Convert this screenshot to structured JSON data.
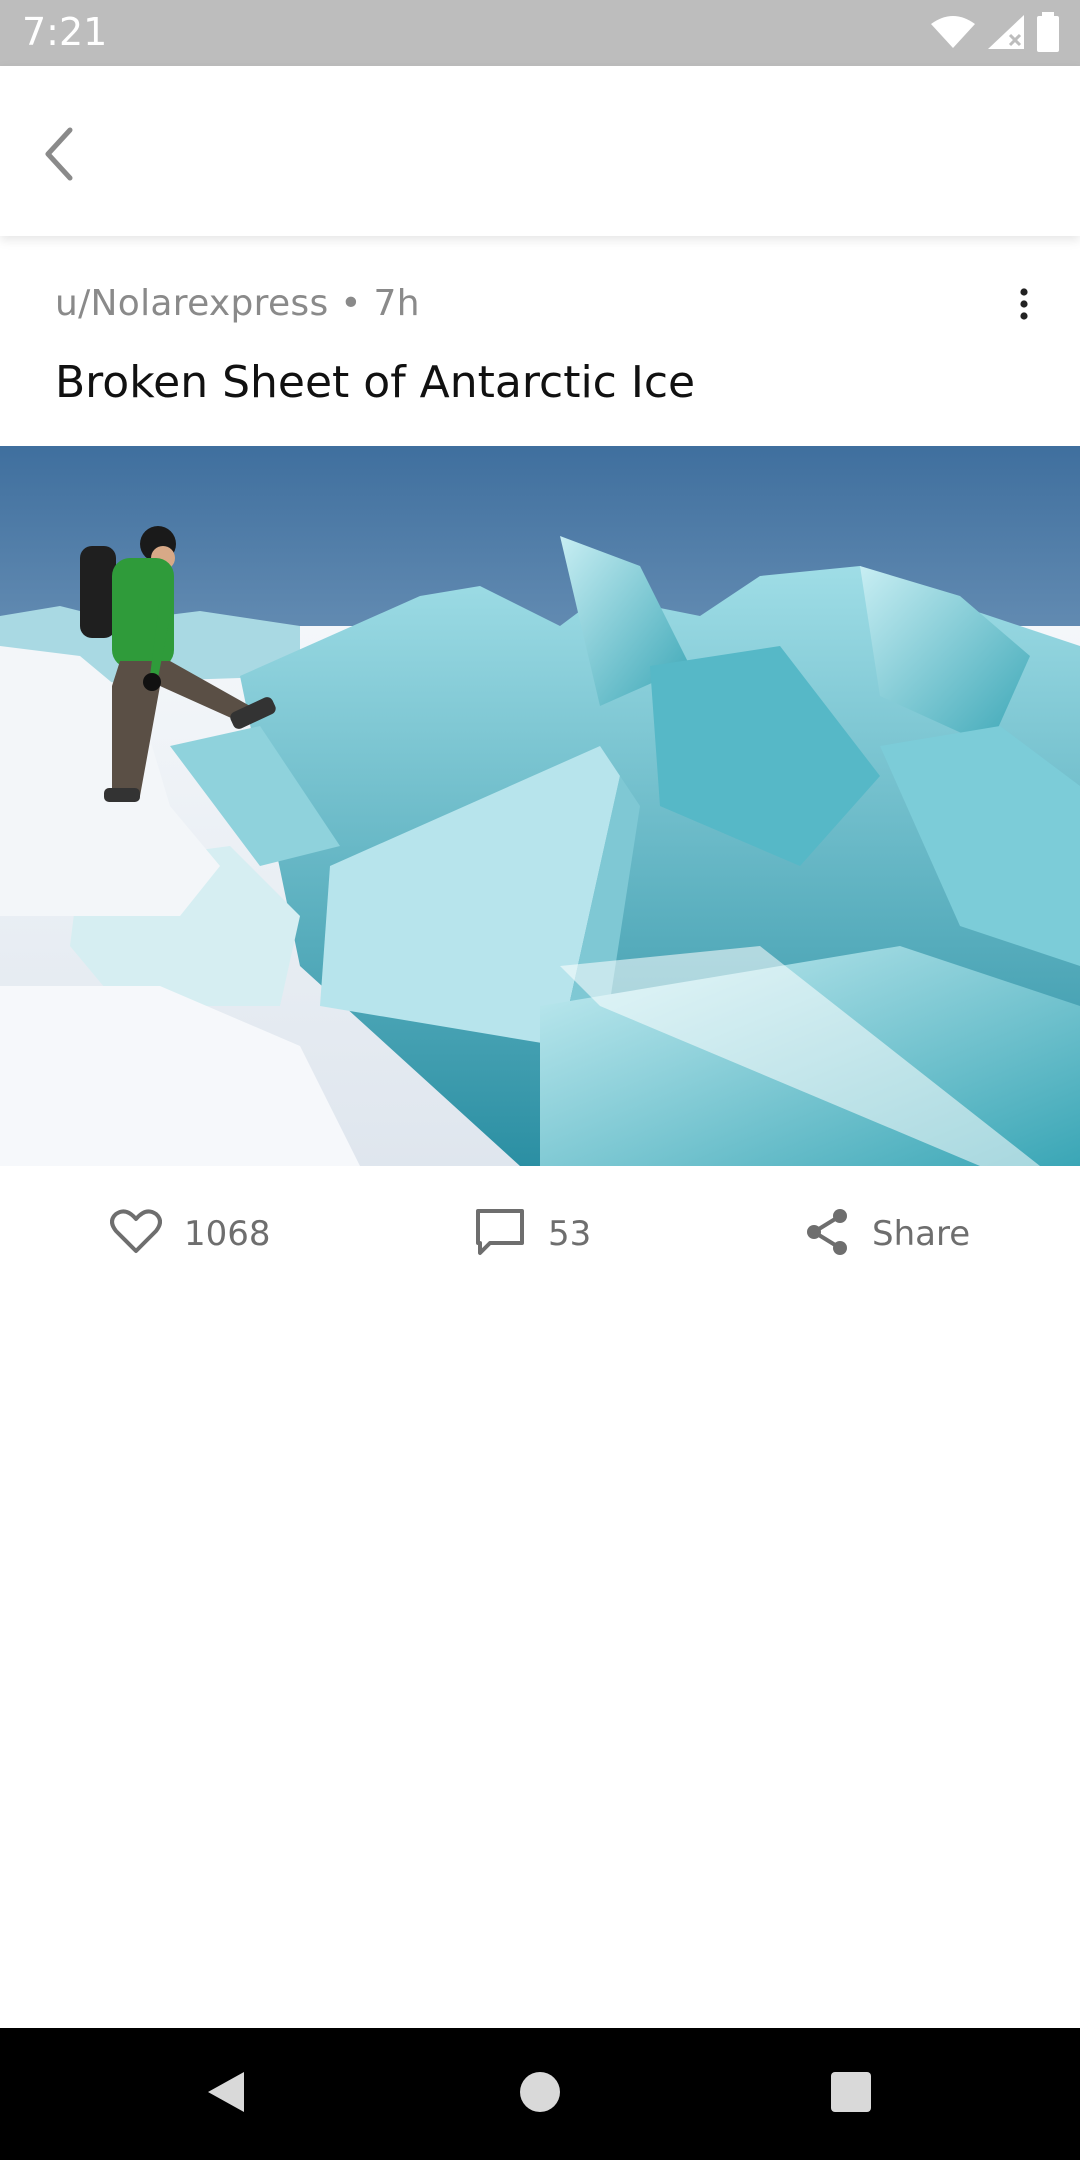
{
  "status_bar": {
    "time": "7:21",
    "icons": [
      "wifi-icon",
      "signal-icon",
      "battery-icon"
    ]
  },
  "app_bar": {
    "back_icon": "chevron-left-icon"
  },
  "post": {
    "author": "u/Nolarexpress",
    "age": "7h",
    "meta": "u/Nolarexpress • 7h",
    "title": "Broken Sheet of Antarctic Ice",
    "image_description_icon": "photo"
  },
  "actions": {
    "likes": "1068",
    "comments": "53",
    "share_label": "Share"
  },
  "nav_bar": {
    "buttons": [
      "back-triangle-icon",
      "home-circle-icon",
      "recents-square-icon"
    ]
  },
  "colors": {
    "status_bar": "#bdbdbd",
    "text_primary": "#111111",
    "text_secondary": "#8a8a8a",
    "icon": "#6e6e6e"
  }
}
